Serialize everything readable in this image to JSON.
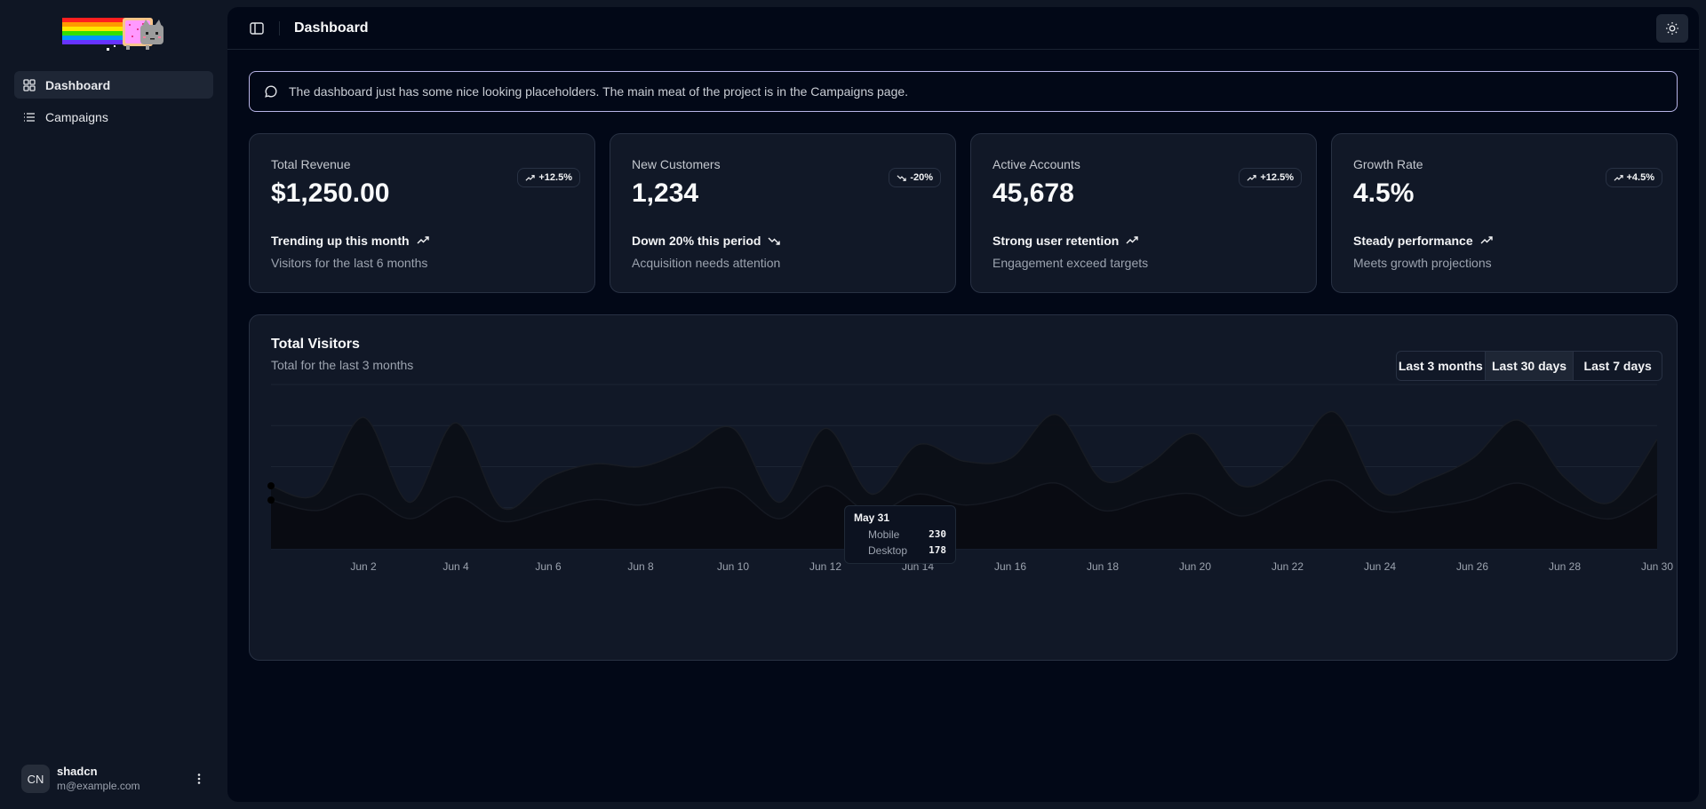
{
  "sidebar": {
    "items": [
      {
        "label": "Dashboard",
        "icon": "dashboard-icon",
        "active": true
      },
      {
        "label": "Campaigns",
        "icon": "list-icon",
        "active": false
      }
    ],
    "user": {
      "initials": "CN",
      "name": "shadcn",
      "email": "m@example.com"
    }
  },
  "header": {
    "title": "Dashboard"
  },
  "alert": {
    "text": "The dashboard just has some nice looking placeholders. The main meat of the project is in the Campaigns page."
  },
  "cards": [
    {
      "label": "Total Revenue",
      "value": "$1,250.00",
      "badge": "+12.5%",
      "direction": "up",
      "trend": "Trending up this month",
      "sub": "Visitors for the last 6 months"
    },
    {
      "label": "New Customers",
      "value": "1,234",
      "badge": "-20%",
      "direction": "down",
      "trend": "Down 20% this period",
      "sub": "Acquisition needs attention"
    },
    {
      "label": "Active Accounts",
      "value": "45,678",
      "badge": "+12.5%",
      "direction": "up",
      "trend": "Strong user retention",
      "sub": "Engagement exceed targets"
    },
    {
      "label": "Growth Rate",
      "value": "4.5%",
      "badge": "+4.5%",
      "direction": "up",
      "trend": "Steady performance",
      "sub": "Meets growth projections"
    }
  ],
  "visitors": {
    "title": "Total Visitors",
    "subtitle": "Total for the last 3 months",
    "ranges": [
      "Last 3 months",
      "Last 30 days",
      "Last 7 days"
    ],
    "active_range": "Last 30 days",
    "tooltip": {
      "date": "May 31",
      "rows": [
        {
          "label": "Mobile",
          "value": "230"
        },
        {
          "label": "Desktop",
          "value": "178"
        }
      ]
    }
  },
  "chart_data": {
    "type": "area",
    "title": "Total Visitors",
    "x": [
      "May 31",
      "Jun 1",
      "Jun 2",
      "Jun 3",
      "Jun 4",
      "Jun 5",
      "Jun 6",
      "Jun 7",
      "Jun 8",
      "Jun 9",
      "Jun 10",
      "Jun 11",
      "Jun 12",
      "Jun 13",
      "Jun 14",
      "Jun 15",
      "Jun 16",
      "Jun 17",
      "Jun 18",
      "Jun 19",
      "Jun 20",
      "Jun 21",
      "Jun 22",
      "Jun 23",
      "Jun 24",
      "Jun 25",
      "Jun 26",
      "Jun 27",
      "Jun 28",
      "Jun 29",
      "Jun 30"
    ],
    "tick_labels": [
      "Jun 2",
      "Jun 4",
      "Jun 6",
      "Jun 8",
      "Jun 10",
      "Jun 12",
      "Jun 14",
      "Jun 16",
      "Jun 18",
      "Jun 20",
      "Jun 22",
      "Jun 24",
      "Jun 26",
      "Jun 28",
      "Jun 30"
    ],
    "series": [
      {
        "name": "Mobile",
        "values": [
          230,
          200,
          480,
          170,
          460,
          150,
          260,
          310,
          300,
          360,
          440,
          170,
          440,
          200,
          380,
          320,
          330,
          490,
          250,
          310,
          420,
          230,
          310,
          500,
          210,
          250,
          330,
          470,
          260,
          170,
          400
        ]
      },
      {
        "name": "Desktop",
        "values": [
          178,
          140,
          200,
          110,
          190,
          100,
          140,
          180,
          160,
          200,
          220,
          110,
          230,
          130,
          200,
          160,
          190,
          240,
          140,
          180,
          200,
          120,
          190,
          250,
          140,
          150,
          180,
          240,
          160,
          110,
          200
        ]
      }
    ],
    "ylim": [
      0,
      600
    ],
    "grid": true,
    "colors": {
      "mobile": "#0c0f16",
      "desktop": "#0a0c12",
      "grid": "#1c2433"
    }
  }
}
